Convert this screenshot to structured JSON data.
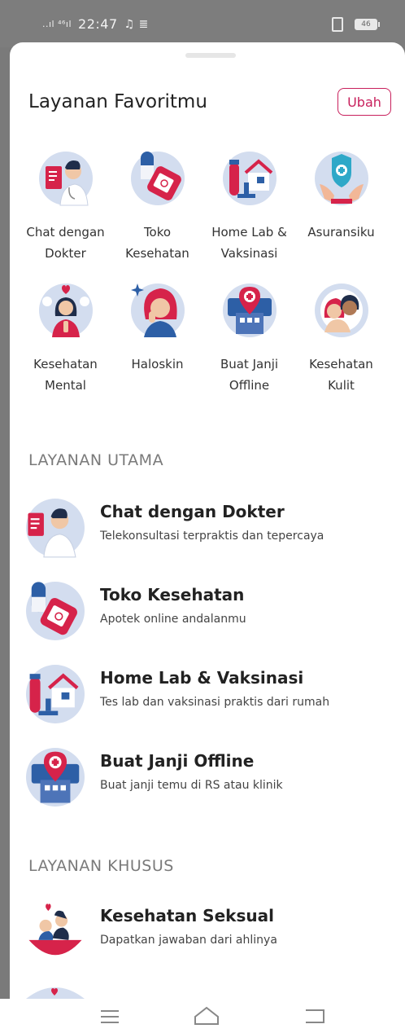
{
  "status_bar": {
    "signal": "..ıl ⁴⁶ıl",
    "time": "22:47",
    "extra": "♫ ≣",
    "battery": "46"
  },
  "favorites": {
    "title": "Layanan Favoritmu",
    "edit_label": "Ubah",
    "items": [
      {
        "label": "Chat dengan Dokter",
        "icon": "doctor-chat-icon"
      },
      {
        "label": "Toko Kesehatan",
        "icon": "health-store-icon"
      },
      {
        "label": "Home Lab & Vaksinasi",
        "icon": "home-lab-icon"
      },
      {
        "label": "Asuransiku",
        "icon": "insurance-icon"
      },
      {
        "label": "Kesehatan Mental",
        "icon": "mental-health-icon"
      },
      {
        "label": "Haloskin",
        "icon": "haloskin-icon"
      },
      {
        "label": "Buat Janji Offline",
        "icon": "offline-appointment-icon"
      },
      {
        "label": "Kesehatan Kulit",
        "icon": "skin-health-icon"
      }
    ]
  },
  "main_services": {
    "title": "LAYANAN UTAMA",
    "items": [
      {
        "title": "Chat dengan Dokter",
        "subtitle": "Telekonsultasi terpraktis dan tepercaya"
      },
      {
        "title": "Toko Kesehatan",
        "subtitle": "Apotek online andalanmu"
      },
      {
        "title": "Home Lab & Vaksinasi",
        "subtitle": "Tes lab dan vaksinasi praktis dari rumah"
      },
      {
        "title": "Buat Janji Offline",
        "subtitle": "Buat janji temu di RS atau klinik"
      }
    ]
  },
  "special_services": {
    "title": "LAYANAN KHUSUS",
    "items": [
      {
        "title": "Kesehatan Seksual",
        "subtitle": "Dapatkan jawaban dari ahlinya"
      }
    ]
  },
  "colors": {
    "accent": "#c8205c",
    "icon_circle": "#d3ddef",
    "icon_red": "#d6234a",
    "icon_blue": "#2d5fa6"
  }
}
